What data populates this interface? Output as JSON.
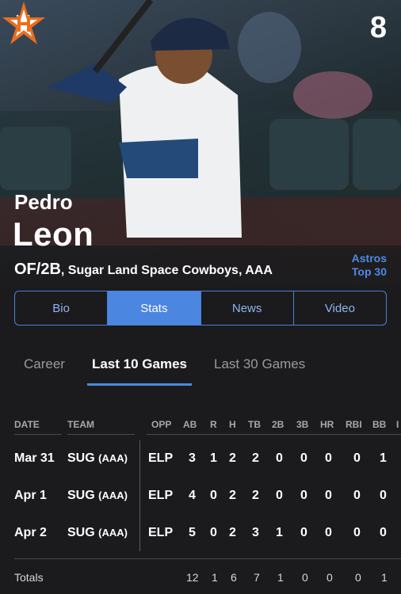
{
  "player": {
    "jersey": "8",
    "first_name": "Pedro",
    "last_name": "Leon",
    "position": "OF/2B",
    "team_line": ", Sugar Land Space Cowboys, AAA"
  },
  "org": {
    "label_line1": "Astros",
    "label_line2": "Top 30"
  },
  "tabs": [
    "Bio",
    "Stats",
    "News",
    "Video"
  ],
  "active_tab": "Stats",
  "subtabs": [
    "Career",
    "Last 10 Games",
    "Last 30 Games"
  ],
  "active_subtab": "Last 10 Games",
  "table": {
    "headers": [
      "DATE",
      "TEAM",
      "OPP",
      "AB",
      "R",
      "H",
      "TB",
      "2B",
      "3B",
      "HR",
      "RBI",
      "BB",
      "I"
    ],
    "rows": [
      {
        "date": "Mar 31",
        "team": "SUG",
        "level": "(AAA)",
        "opp": "ELP",
        "ab": "3",
        "r": "1",
        "h": "2",
        "tb": "2",
        "2b": "0",
        "3b": "0",
        "hr": "0",
        "rbi": "0",
        "bb": "1"
      },
      {
        "date": "Apr 1",
        "team": "SUG",
        "level": "(AAA)",
        "opp": "ELP",
        "ab": "4",
        "r": "0",
        "h": "2",
        "tb": "2",
        "2b": "0",
        "3b": "0",
        "hr": "0",
        "rbi": "0",
        "bb": "0"
      },
      {
        "date": "Apr 2",
        "team": "SUG",
        "level": "(AAA)",
        "opp": "ELP",
        "ab": "5",
        "r": "0",
        "h": "2",
        "tb": "3",
        "2b": "1",
        "3b": "0",
        "hr": "0",
        "rbi": "0",
        "bb": "0"
      }
    ],
    "totals": {
      "label": "Totals",
      "ab": "12",
      "r": "1",
      "h": "6",
      "tb": "7",
      "2b": "1",
      "3b": "0",
      "hr": "0",
      "rbi": "0",
      "bb": "1"
    }
  },
  "colors": {
    "accent": "#4b86e0",
    "background": "#1b1b1d",
    "astros_orange": "#eb6e1f",
    "astros_navy": "#002d62"
  },
  "icons": {
    "close": "close-icon",
    "logo": "astros-star-logo"
  }
}
